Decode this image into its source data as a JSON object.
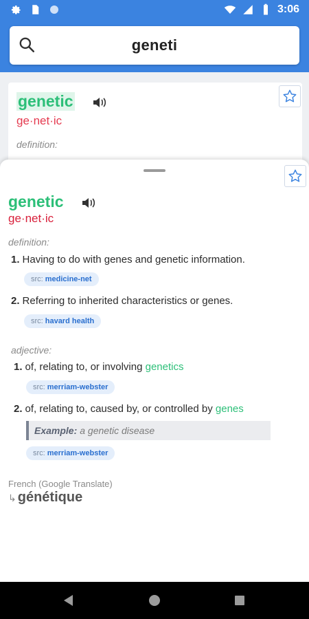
{
  "status_bar": {
    "time": "3:06",
    "left_icons": [
      "gear-icon",
      "sim-card-icon",
      "circle-icon"
    ],
    "right_icons": [
      "wifi-icon",
      "signal-icon",
      "battery-icon"
    ]
  },
  "search": {
    "query": "geneti",
    "icon": "search-icon"
  },
  "background_card": {
    "word": "genetic",
    "syllables": "ge·net·ic",
    "definition_label": "definition:"
  },
  "entry": {
    "word": "genetic",
    "syllables": "ge·net·ic",
    "definition_label": "definition:",
    "definitions": [
      {
        "num": "1.",
        "text": "Having to do with genes and genetic  information.",
        "src_prefix": "src:",
        "src": "medicine-net"
      },
      {
        "num": "2.",
        "text": "Referring to inherited characteristics or genes.",
        "src_prefix": "src:",
        "src": "havard health"
      }
    ],
    "adjective_label": "adjective:",
    "adjective": [
      {
        "num": "1.",
        "text": "of, relating to, or involving ",
        "link": "genetics",
        "src_prefix": "src:",
        "src": "merriam-webster"
      },
      {
        "num": "2.",
        "text": "of, relating to, caused by, or controlled by ",
        "link": "genes",
        "src_prefix": "src:",
        "src": "merriam-webster"
      }
    ],
    "example_label": "Example:",
    "example_text": "a genetic disease",
    "translation_label": "French (Google Translate)",
    "translation_arrow": "↳",
    "translation": "génétique"
  },
  "colors": {
    "header": "#3b83e0",
    "word": "#2cbf78",
    "syllables": "#d81f3a",
    "chip_bg": "#e4eefb",
    "chip_text": "#2a6fcf"
  }
}
